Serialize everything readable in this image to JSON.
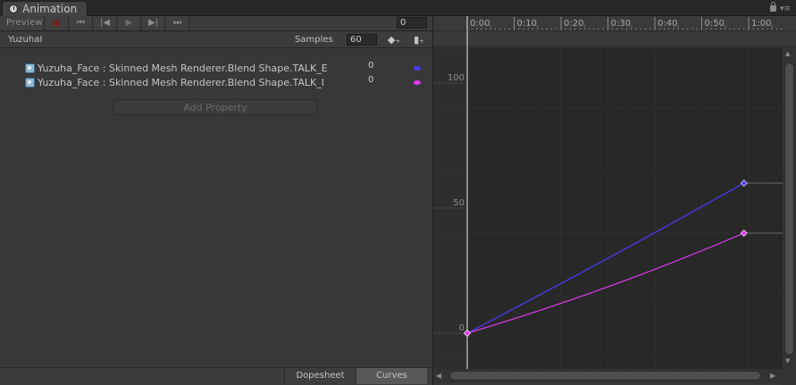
{
  "window": {
    "tab_title": "Animation",
    "icons": {
      "tab_icon": "clock-icon",
      "lock": "lock-icon",
      "menu": "menu-icon"
    }
  },
  "toolbar": {
    "preview_label": "Preview",
    "record_icon": "record-icon",
    "first_key_icon": "first-key-icon",
    "prev_key_icon": "prev-key-icon",
    "play_icon": "play-icon",
    "next_key_icon": "next-key-icon",
    "last_key_icon": "last-key-icon",
    "current_frame": "0"
  },
  "clip": {
    "name": "YuzuhaI",
    "samples_label": "Samples",
    "samples_value": "60",
    "add_keyframe_icon": "add-keyframe-icon",
    "add_event_icon": "add-event-icon"
  },
  "properties": [
    {
      "name": "Yuzuha_Face : Skinned Mesh Renderer.Blend Shape.TALK_E",
      "value": "0",
      "color": "#4a3cff",
      "icon": "skinned-mesh-icon"
    },
    {
      "name": "Yuzuha_Face : Skinned Mesh Renderer.Blend Shape.TALK_I",
      "value": "0",
      "color": "#e13cf0",
      "icon": "skinned-mesh-icon"
    }
  ],
  "add_property_label": "Add Property",
  "bottom_tabs": {
    "dopesheet": "Dopesheet",
    "curves": "Curves",
    "active": "Curves"
  },
  "chart_data": {
    "type": "line",
    "x_unit": "seconds",
    "x_ticks": [
      "0:00",
      "0:10",
      "0:20",
      "0:30",
      "0:40",
      "0:50",
      "1:00"
    ],
    "y_ticks": [
      "0",
      "50",
      "100"
    ],
    "xlim": [
      0,
      60
    ],
    "ylim": [
      0,
      100
    ],
    "grid": true,
    "series": [
      {
        "key": "TALK_E",
        "color": "#4a3cff",
        "x": [
          0,
          1.0
        ],
        "y": [
          0,
          60
        ],
        "x_time": [
          "0:00",
          "0:59"
        ]
      },
      {
        "key": "TALK_I",
        "color": "#e13cf0",
        "x": [
          0,
          1.0
        ],
        "y": [
          0,
          40
        ],
        "x_time": [
          "0:00",
          "0:59"
        ]
      }
    ]
  }
}
